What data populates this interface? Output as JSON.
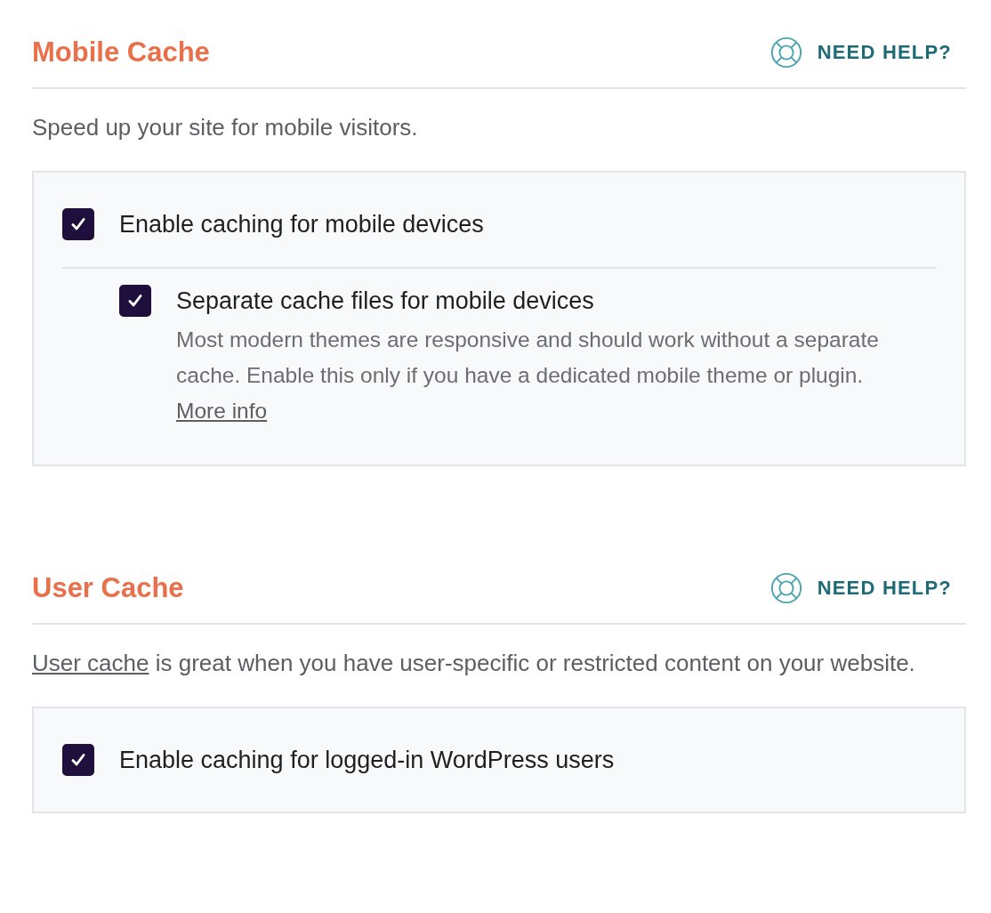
{
  "sections": [
    {
      "title": "Mobile Cache",
      "help": "NEED HELP?",
      "description": [
        {
          "kind": "text",
          "text": "Speed up your site for mobile visitors."
        }
      ],
      "options": [
        {
          "label": "Enable caching for mobile devices",
          "checked": true,
          "children": [
            {
              "label": "Separate cache files for mobile devices",
              "checked": true,
              "note": "Most modern themes are responsive and should work without a separate cache. Enable this only if you have a dedicated mobile theme or plugin.",
              "link": "More info"
            }
          ]
        }
      ]
    },
    {
      "title": "User Cache",
      "help": "NEED HELP?",
      "description": [
        {
          "kind": "link",
          "text": "User cache"
        },
        {
          "kind": "text",
          "text": " is great when you have user-specific or restricted content on your website."
        }
      ],
      "options": [
        {
          "label": "Enable caching for logged-in WordPress users",
          "checked": true
        }
      ]
    }
  ]
}
